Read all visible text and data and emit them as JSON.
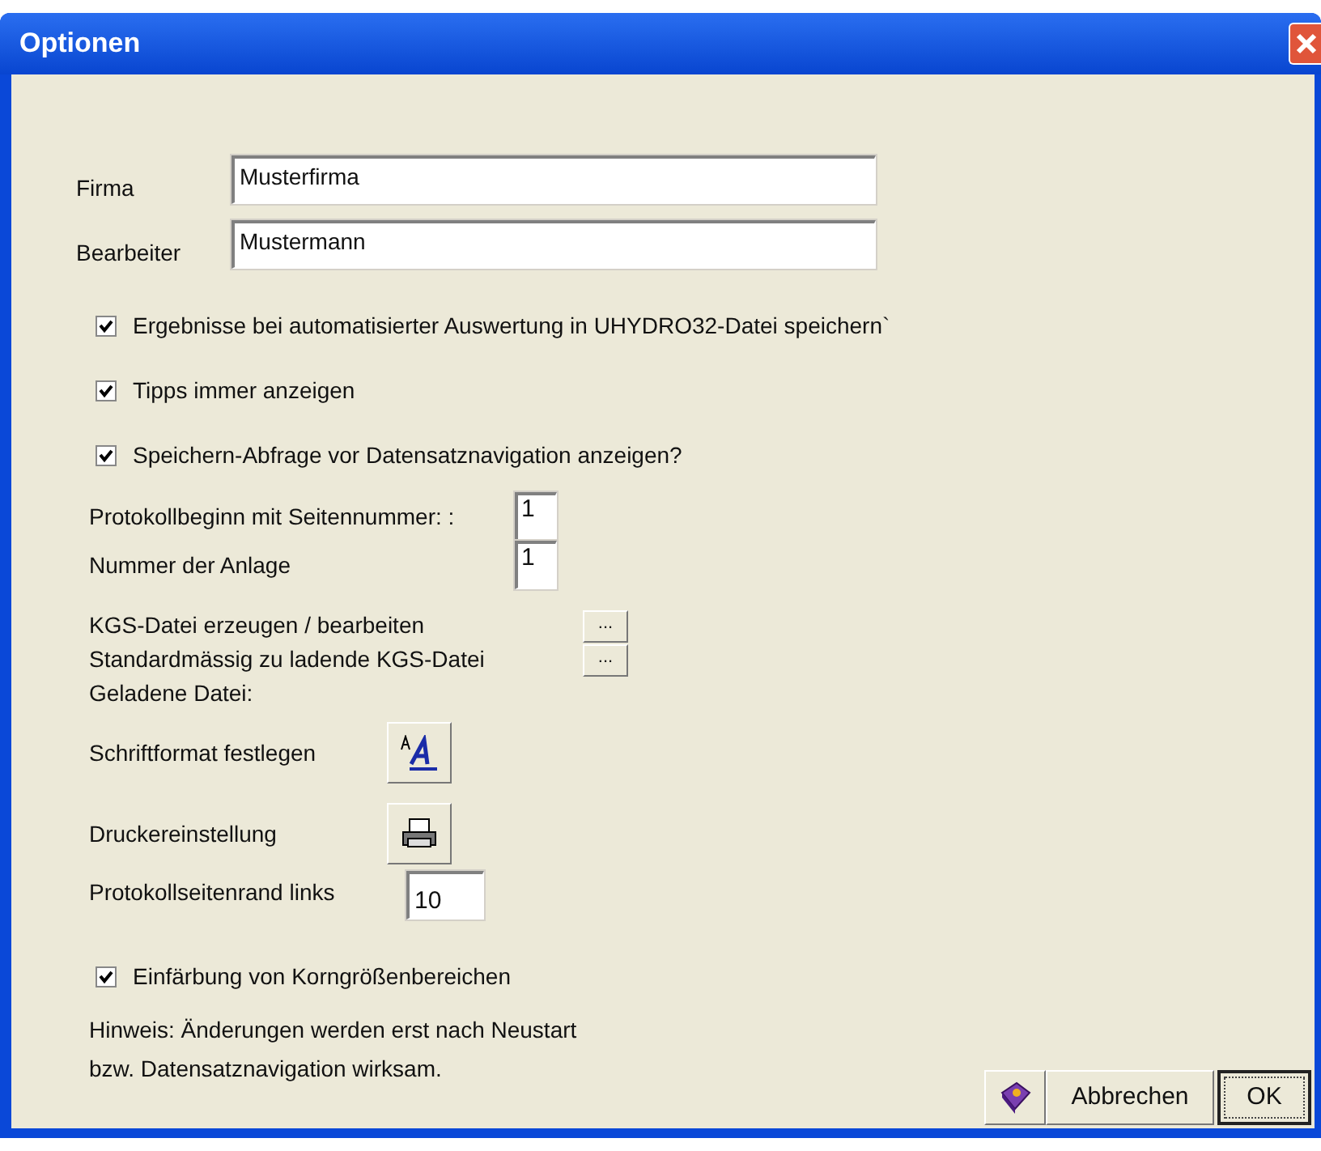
{
  "window": {
    "title": "Optionen"
  },
  "fields": [
    {
      "label": "Firma",
      "value": "Musterfirma"
    },
    {
      "label": "Bearbeiter",
      "value": "Mustermann"
    }
  ],
  "checkboxes": [
    {
      "label": "Ergebnisse bei automatisierter Auswertung in UHYDRO32-Datei speichern`",
      "checked": true
    },
    {
      "label": "Tipps immer anzeigen",
      "checked": true
    },
    {
      "label": "Speichern-Abfrage vor Datensatznavigation anzeigen?",
      "checked": true
    }
  ],
  "numbers": [
    {
      "label": "Protokollbeginn mit Seitennummer: :",
      "value": "1"
    },
    {
      "label": "Nummer der Anlage",
      "value": "1"
    }
  ],
  "kgs": [
    {
      "label": "KGS-Datei erzeugen / bearbeiten",
      "button": "..."
    },
    {
      "label": "Standardmässig zu ladende KGS-Datei",
      "button": "..."
    }
  ],
  "loaded_file": {
    "label": "Geladene Datei:"
  },
  "tools": [
    {
      "kind": "font",
      "label": "Schriftformat festlegen"
    },
    {
      "kind": "printer",
      "label": "Druckereinstellung"
    }
  ],
  "margin": {
    "label": "Protokollseitenrand links",
    "value": "10"
  },
  "color_option": {
    "label": "Einfärbung von Korngrößenbereichen",
    "checked": true
  },
  "hint": [
    "Hinweis: Änderungen werden erst nach  Neustart",
    "bzw. Datensatznavigation wirksam."
  ],
  "buttons": [
    {
      "kind": "help"
    },
    {
      "kind": "text",
      "label": "Abbrechen",
      "default": false
    },
    {
      "kind": "text",
      "label": "OK",
      "default": true
    }
  ]
}
